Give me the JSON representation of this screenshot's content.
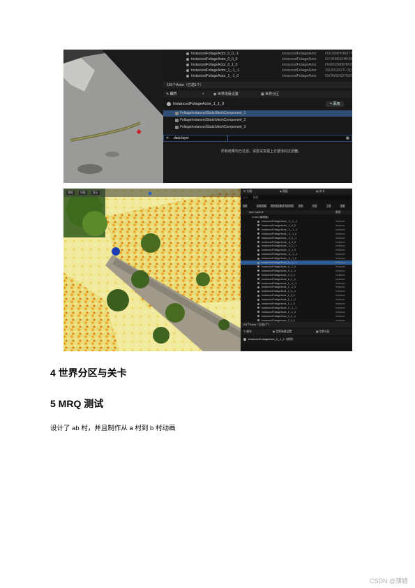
{
  "figure1": {
    "outliner_rows": [
      {
        "name": "InstancedFoliageActor_0_0_-1",
        "type": "InstancedFoliageActor",
        "id": "F5D1B4HNN6ITYI"
      },
      {
        "name": "InstancedFoliageActor_0_0_0",
        "type": "InstancedFoliageActor",
        "id": "GY2RM5S3HK6B"
      },
      {
        "name": "InstancedFoliageActor_0_1_0",
        "type": "InstancedFoliageActor",
        "id": "FNR6S5M8PBV0"
      },
      {
        "name": "InstancedFoliageActor_1_-1_-1",
        "type": "InstancedFoliageActor",
        "id": "3SU0SJ0G7LOQ"
      },
      {
        "name": "InstancedFoliageActor_1_-1_0",
        "type": "InstancedFoliageActor",
        "id": "5SOWS5S8YRZN"
      }
    ],
    "actor_count": "193个Actor（已选1个）",
    "tabs": {
      "details": "细节",
      "world_settings": "世界场景设置",
      "world_partition": "世界分区"
    },
    "selected_actor": "InstancedFoliageActor_1_1_0",
    "add_button": "+ 添加",
    "components": [
      "FoliageInstancedStaticMeshComponent_1",
      "FoliageInstancedStaticMeshComponent_2",
      "FoliageInstancedStaticMeshComponent_3"
    ],
    "search_value": "data layer",
    "empty_message": "所有结果均已过滤。请尝试变更上方激活的过滤器。"
  },
  "figure2": {
    "panel_tabs": {
      "outliner": "大纲",
      "layers": "图层",
      "datalayers": "关卡"
    },
    "search_placeholder": "搜索",
    "filter_chips": [
      "设置",
      "加载/卸载",
      "同步激活/取消",
      "内容浏览",
      "实例",
      "内容",
      "工具",
      "加载"
    ],
    "column_header": "Item Label ▾",
    "column_type": "类型",
    "root_item": "Cma0 (编辑器)",
    "rows": [
      "InstancedFoliageActor_-1_-1_-1",
      "InstancedFoliageActor_-1_0_0",
      "InstancedFoliageActor_-2_-1_-1",
      "InstancedFoliageActor_-2_-1_0",
      "InstancedFoliageActor_-2_0_-1",
      "InstancedFoliageActor_-2_0_0",
      "InstancedFoliageActor_-2_1_-1",
      "InstancedFoliageActor_-2_1_0",
      "InstancedFoliageActor_-3_-1_-1",
      "InstancedFoliageActor_-3_-1_0",
      "InstancedFoliageActor_0_-1_-1",
      "InstancedFoliageActor_0_-1_0",
      "InstancedFoliageActor_0_0_-1",
      "InstancedFoliageActor_0_0_0",
      "InstancedFoliageActor_0_1_-1",
      "InstancedFoliageActor_1_-1_-1",
      "InstancedFoliageActor_1_-1_0",
      "InstancedFoliageActor_1_0_-1",
      "InstancedFoliageActor_1_0_0",
      "InstancedFoliageActor_1_1_-1",
      "InstancedFoliageActor_1_1_0",
      "InstancedFoliageActor_2_-1_-1",
      "InstancedFoliageActor_2_-1_0",
      "InstancedFoliageActor_2_0_-1",
      "InstancedFoliageActor_2_0_0"
    ],
    "selected_row_index": 10,
    "row_type": "Instance",
    "actor_count": "193个Actor（已选1个）",
    "bottom_tabs": {
      "details": "细节",
      "world_settings": "世界场景设置",
      "world_partition": "世界分区"
    },
    "bottom_item": "InstancedFoliageActor_0_-1_0（实例）",
    "toolbar_labels": [
      "透视",
      "光照",
      "显示"
    ]
  },
  "text": {
    "heading4": "4 世界分区与关卡",
    "heading5": "5 MRQ 测试",
    "paragraph": "设计了 ab 村，并且制作从 a 村到 b 村动画",
    "watermark": "CSDN @薄婧"
  }
}
